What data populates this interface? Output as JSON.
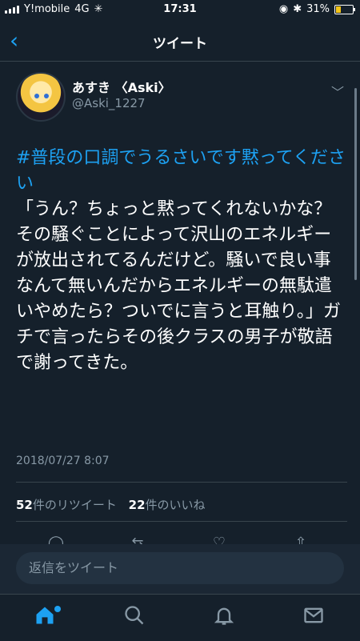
{
  "status_bar": {
    "carrier": "Y!mobile",
    "network": "4G",
    "time": "17:31",
    "battery_percent": "31%",
    "battery_level": 0.31
  },
  "nav": {
    "title": "ツイート"
  },
  "tweet": {
    "author_name": "あすき 〈Aski〉",
    "author_handle": "@Aski_1227",
    "hashtag": "#普段の口調でうるさいです黙ってください",
    "body": "「うん？ちょっと黙ってくれないかな？その騒ぐことによって沢山のエネルギーが放出されてるんだけど。騒いで良い事なんて無いんだからエネルギーの無駄遣いやめたら？ついでに言うと耳触り。」ガチで言ったらその後クラスの男子が敬語で謝ってきた。",
    "timestamp": "2018/07/27 8:07"
  },
  "stats": {
    "retweet_count": "52",
    "retweet_label": "件のリツイート",
    "like_count": "22",
    "like_label": "件のいいね"
  },
  "reply": {
    "placeholder": "返信をツイート"
  },
  "colors": {
    "accent": "#1da1f2",
    "background": "#15202b",
    "muted": "#8899a6"
  },
  "icons": [
    "back-chevron-icon",
    "chevron-down-icon",
    "reply-icon",
    "retweet-icon",
    "like-icon",
    "share-icon",
    "home-icon",
    "search-icon",
    "notifications-icon",
    "messages-icon"
  ]
}
